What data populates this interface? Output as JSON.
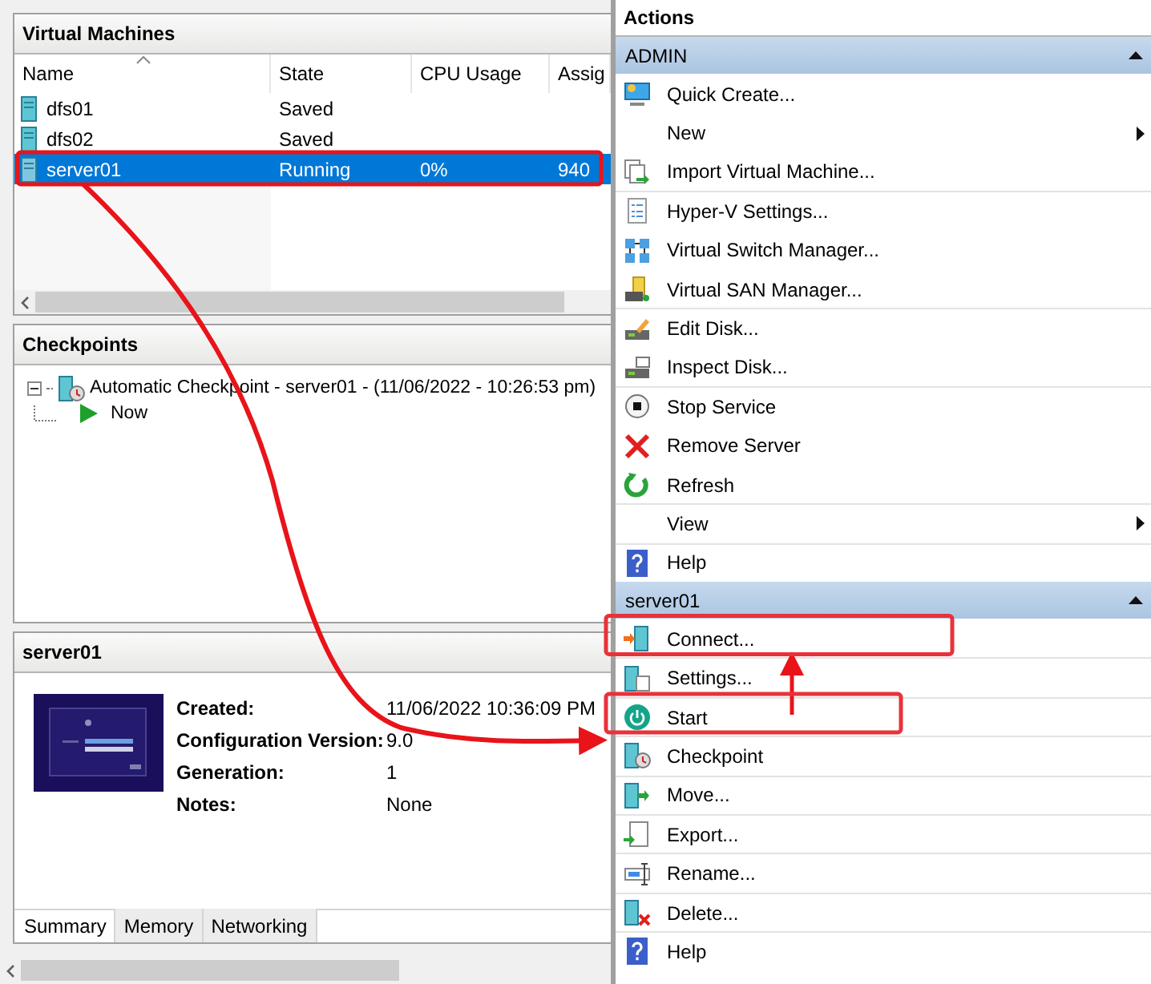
{
  "vm_panel": {
    "title": "Virtual Machines",
    "columns": [
      {
        "label": "Name",
        "sorted": true
      },
      {
        "label": "State",
        "sorted": false
      },
      {
        "label": "CPU Usage",
        "sorted": false
      },
      {
        "label": "Assig",
        "sorted": false
      }
    ],
    "rows": [
      {
        "name": "dfs01",
        "state": "Saved",
        "cpu": "",
        "assigned": "",
        "selected": false
      },
      {
        "name": "dfs02",
        "state": "Saved",
        "cpu": "",
        "assigned": "",
        "selected": false
      },
      {
        "name": "server01",
        "state": "Running",
        "cpu": "0%",
        "assigned": "940",
        "selected": true,
        "highlighted": true
      }
    ]
  },
  "checkpoints": {
    "title": "Checkpoints",
    "tree": [
      {
        "label": "Automatic Checkpoint - server01 - (11/06/2022 - 10:26:53 pm)",
        "kind": "checkpoint",
        "expanded": true,
        "children": [
          {
            "label": "Now",
            "kind": "now"
          }
        ]
      }
    ]
  },
  "details": {
    "title": "server01",
    "fields": [
      {
        "label": "Created:",
        "value": "11/06/2022 10:36:09 PM"
      },
      {
        "label": "Configuration Version:",
        "value": "9.0"
      },
      {
        "label": "Generation:",
        "value": "1"
      },
      {
        "label": "Notes:",
        "value": "None"
      }
    ],
    "tabs": [
      {
        "label": "Summary",
        "selected": true
      },
      {
        "label": "Memory",
        "selected": false
      },
      {
        "label": "Networking",
        "selected": false
      }
    ]
  },
  "actions": {
    "title": "Actions",
    "sections": [
      {
        "title": "ADMIN",
        "expanded": true,
        "items": [
          {
            "label": "Quick Create...",
            "kind": "create",
            "separated": false
          },
          {
            "label": "New",
            "kind": "submenu",
            "separated": false
          },
          {
            "label": "Import Virtual Machine...",
            "kind": "import",
            "separated": false
          },
          {
            "label": "Hyper-V Settings...",
            "kind": "settings",
            "separated": true
          },
          {
            "label": "Virtual Switch Manager...",
            "kind": "switch",
            "separated": false
          },
          {
            "label": "Virtual SAN Manager...",
            "kind": "san",
            "separated": false
          },
          {
            "label": "Edit Disk...",
            "kind": "edit",
            "separated": true
          },
          {
            "label": "Inspect Disk...",
            "kind": "inspect",
            "separated": false
          },
          {
            "label": "Stop Service",
            "kind": "stop",
            "separated": true
          },
          {
            "label": "Remove Server",
            "kind": "remove",
            "separated": false
          },
          {
            "label": "Refresh",
            "kind": "refresh",
            "separated": false
          },
          {
            "label": "View",
            "kind": "submenu",
            "separated": true
          },
          {
            "label": "Help",
            "kind": "help",
            "separated": true
          }
        ]
      },
      {
        "title": "server01",
        "expanded": true,
        "items": [
          {
            "label": "Connect...",
            "kind": "connect",
            "separated": false,
            "highlighted": true
          },
          {
            "label": "Settings...",
            "kind": "vmsettings",
            "separated": true
          },
          {
            "label": "Start",
            "kind": "start",
            "separated": true,
            "highlighted": true
          },
          {
            "label": "Checkpoint",
            "kind": "checkpoint",
            "separated": true
          },
          {
            "label": "Move...",
            "kind": "move",
            "separated": true
          },
          {
            "label": "Export...",
            "kind": "export",
            "separated": true
          },
          {
            "label": "Rename...",
            "kind": "rename",
            "separated": true
          },
          {
            "label": "Delete...",
            "kind": "delete",
            "separated": true
          },
          {
            "label": "Help",
            "kind": "help",
            "separated": true
          }
        ]
      }
    ]
  }
}
